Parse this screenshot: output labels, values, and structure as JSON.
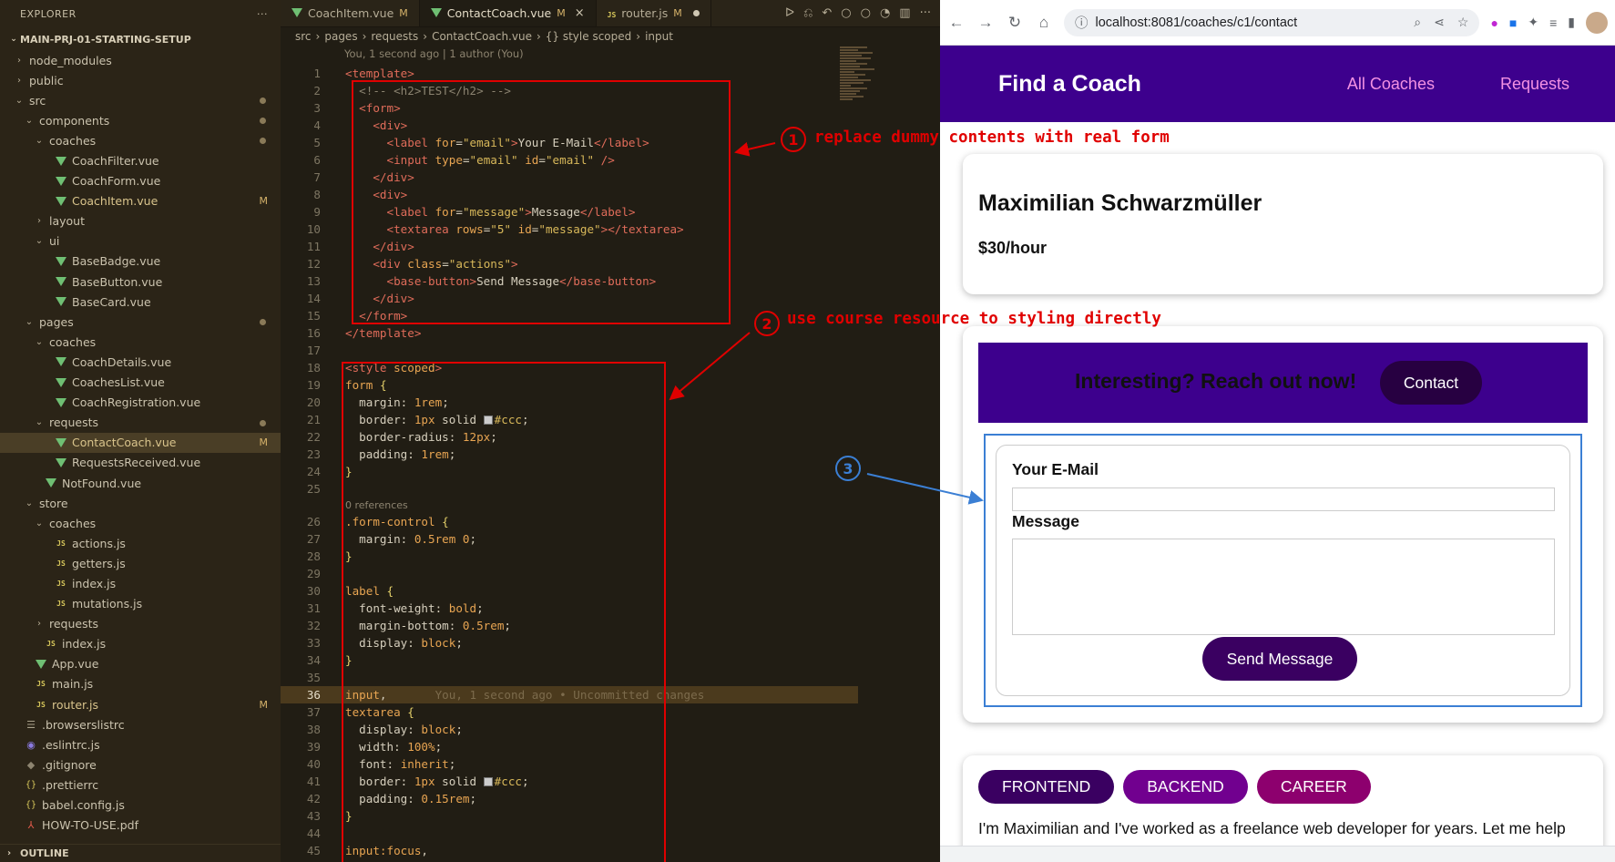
{
  "explorer": {
    "title": "EXPLORER",
    "menu": "···",
    "project": "MAIN-PRJ-01-STARTING-SETUP",
    "outline": "OUTLINE",
    "items": [
      {
        "label": "node_modules",
        "type": "folder",
        "open": false,
        "indent": 1
      },
      {
        "label": "public",
        "type": "folder",
        "open": false,
        "indent": 1
      },
      {
        "label": "src",
        "type": "folder",
        "open": true,
        "indent": 1,
        "dot": true
      },
      {
        "label": "components",
        "type": "folder",
        "open": true,
        "indent": 2,
        "dot": true
      },
      {
        "label": "coaches",
        "type": "folder",
        "open": true,
        "indent": 3,
        "dot": true
      },
      {
        "label": "CoachFilter.vue",
        "type": "vue",
        "indent": 4
      },
      {
        "label": "CoachForm.vue",
        "type": "vue",
        "indent": 4
      },
      {
        "label": "CoachItem.vue",
        "type": "vue",
        "indent": 4,
        "mod": "M"
      },
      {
        "label": "layout",
        "type": "folder",
        "open": false,
        "indent": 3
      },
      {
        "label": "ui",
        "type": "folder",
        "open": true,
        "indent": 3
      },
      {
        "label": "BaseBadge.vue",
        "type": "vue",
        "indent": 4
      },
      {
        "label": "BaseButton.vue",
        "type": "vue",
        "indent": 4
      },
      {
        "label": "BaseCard.vue",
        "type": "vue",
        "indent": 4
      },
      {
        "label": "pages",
        "type": "folder",
        "open": true,
        "indent": 2,
        "dot": true
      },
      {
        "label": "coaches",
        "type": "folder",
        "open": true,
        "indent": 3
      },
      {
        "label": "CoachDetails.vue",
        "type": "vue",
        "indent": 4
      },
      {
        "label": "CoachesList.vue",
        "type": "vue",
        "indent": 4
      },
      {
        "label": "CoachRegistration.vue",
        "type": "vue",
        "indent": 4
      },
      {
        "label": "requests",
        "type": "folder",
        "open": true,
        "indent": 3,
        "dot": true
      },
      {
        "label": "ContactCoach.vue",
        "type": "vue",
        "indent": 4,
        "mod": "M",
        "active": true
      },
      {
        "label": "RequestsReceived.vue",
        "type": "vue",
        "indent": 4
      },
      {
        "label": "NotFound.vue",
        "type": "vue",
        "indent": 3
      },
      {
        "label": "store",
        "type": "folder",
        "open": true,
        "indent": 2
      },
      {
        "label": "coaches",
        "type": "folder",
        "open": true,
        "indent": 3
      },
      {
        "label": "actions.js",
        "type": "js",
        "indent": 4
      },
      {
        "label": "getters.js",
        "type": "js",
        "indent": 4
      },
      {
        "label": "index.js",
        "type": "js",
        "indent": 4
      },
      {
        "label": "mutations.js",
        "type": "js",
        "indent": 4
      },
      {
        "label": "requests",
        "type": "folder",
        "open": false,
        "indent": 3
      },
      {
        "label": "index.js",
        "type": "js",
        "indent": 3
      },
      {
        "label": "App.vue",
        "type": "vue",
        "indent": 2
      },
      {
        "label": "main.js",
        "type": "js",
        "indent": 2
      },
      {
        "label": "router.js",
        "type": "js",
        "indent": 2,
        "mod": "M"
      },
      {
        "label": ".browserslistrc",
        "type": "lines",
        "indent": 1
      },
      {
        "label": ".eslintrc.js",
        "type": "eslint",
        "indent": 1
      },
      {
        "label": ".gitignore",
        "type": "git",
        "indent": 1
      },
      {
        "label": ".prettierrc",
        "type": "braces",
        "indent": 1
      },
      {
        "label": "babel.config.js",
        "type": "braces",
        "indent": 1
      },
      {
        "label": "HOW-TO-USE.pdf",
        "type": "pdf",
        "indent": 1
      }
    ]
  },
  "editor": {
    "tabs": [
      {
        "label": "CoachItem.vue",
        "mod": "M",
        "type": "vue"
      },
      {
        "label": "ContactCoach.vue",
        "mod": "M",
        "type": "vue",
        "active": true
      },
      {
        "label": "router.js",
        "mod": "M",
        "type": "js",
        "dirty": true
      }
    ],
    "breadcrumb": [
      "src",
      "pages",
      "requests",
      "ContactCoach.vue",
      "{} style scoped",
      "input"
    ],
    "blame_header": "You, 1 second ago | 1 author (You)",
    "codelens": "0 references",
    "inline_blame": "You, 1 second ago • Uncommitted changes"
  },
  "annotations": {
    "a1": {
      "num": "1",
      "text": "replace dummy contents with real form"
    },
    "a2": {
      "num": "2",
      "text": "use course resource to styling directly"
    },
    "a3": {
      "num": "3"
    }
  },
  "browser": {
    "url": "localhost:8081/coaches/c1/contact",
    "app_title": "Find a Coach",
    "nav": [
      "All Coaches",
      "Requests"
    ],
    "coach_name": "Maximilian Schwarzmüller",
    "coach_rate": "$30/hour",
    "cta_text": "Interesting? Reach out now!",
    "cta_button": "Contact",
    "form": {
      "email_label": "Your E-Mail",
      "message_label": "Message",
      "submit": "Send Message"
    },
    "badges": [
      {
        "label": "FRONTEND",
        "color": "#3a0061"
      },
      {
        "label": "BACKEND",
        "color": "#71008f"
      },
      {
        "label": "CAREER",
        "color": "#8d006e"
      }
    ],
    "description": "I'm Maximilian and I've worked as a freelance web developer for years. Let me help",
    "colors": {
      "brand": "#3d008d",
      "nav_link": "#f391e3",
      "annotation_red": "#e00000",
      "annotation_blue": "#3b7fd4"
    }
  }
}
